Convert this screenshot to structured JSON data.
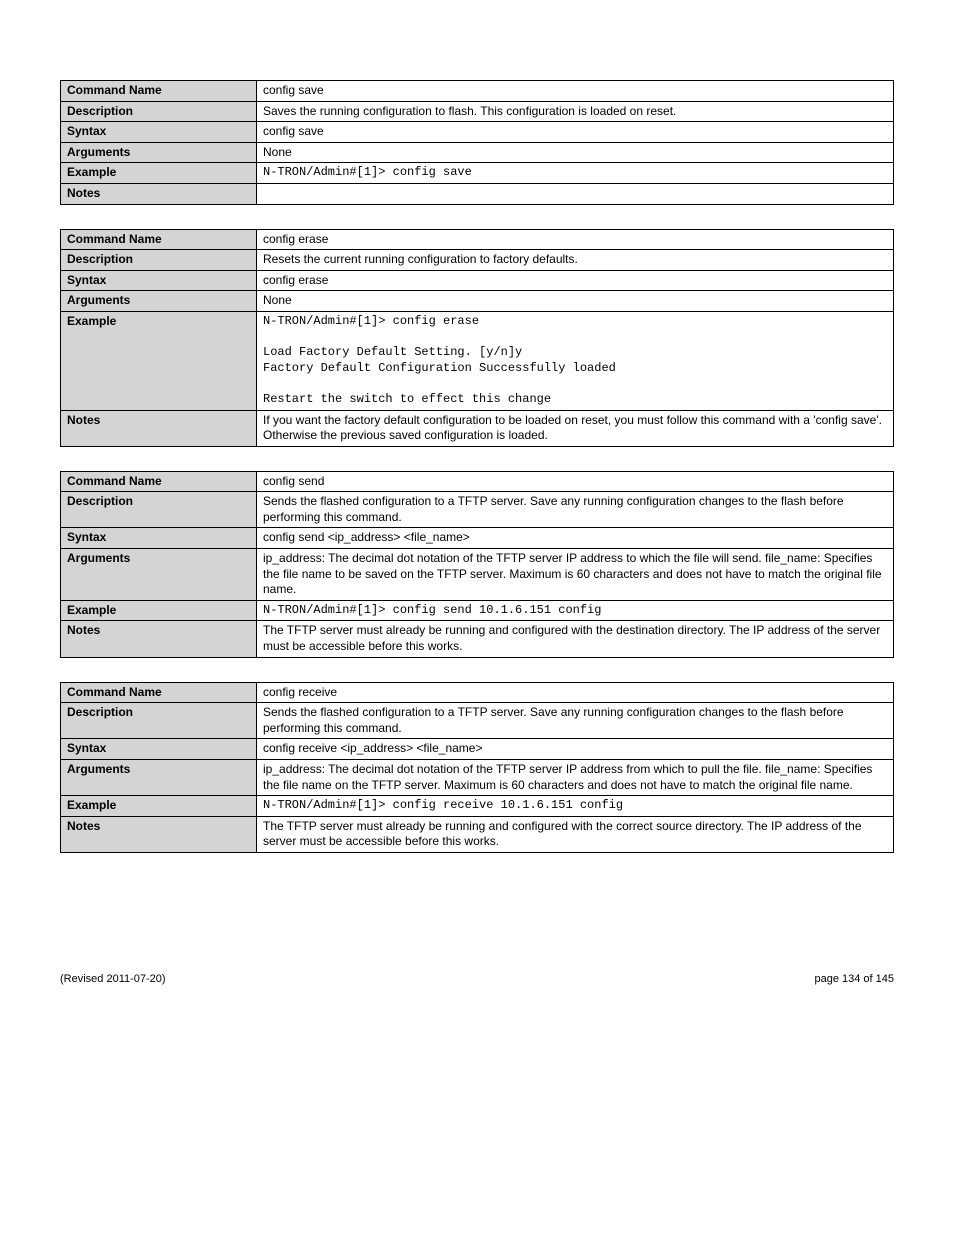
{
  "blocks": [
    {
      "rows": [
        {
          "key": "Command Name",
          "val": "config save",
          "mono": false
        },
        {
          "key": "Description",
          "val": "Saves the running configuration to flash. This configuration is loaded on reset.",
          "mono": false
        },
        {
          "key": "Syntax",
          "val": "config save",
          "mono": false
        },
        {
          "key": "Arguments",
          "val": "None",
          "mono": false
        },
        {
          "key": "Example",
          "val": "N-TRON/Admin#[1]> config save",
          "mono": true
        },
        {
          "key": "Notes",
          "val": "",
          "mono": false
        }
      ]
    },
    {
      "rows": [
        {
          "key": "Command Name",
          "val": "config erase",
          "mono": false
        },
        {
          "key": "Description",
          "val": "Resets the current running configuration to factory defaults.",
          "mono": false
        },
        {
          "key": "Syntax",
          "val": "config erase",
          "mono": false
        },
        {
          "key": "Arguments",
          "val": "None",
          "mono": false
        },
        {
          "key": "Example",
          "val": "N-TRON/Admin#[1]> config erase\n\nLoad Factory Default Setting. [y/n]y\nFactory Default Configuration Successfully loaded\n\nRestart the switch to effect this change",
          "mono": true
        },
        {
          "key": "Notes",
          "val": "If you want the factory default configuration to be loaded on reset, you must follow this command with a 'config save'. Otherwise the previous saved configuration is loaded.",
          "mono": false
        }
      ]
    },
    {
      "rows": [
        {
          "key": "Command Name",
          "val": "config send",
          "mono": false
        },
        {
          "key": "Description",
          "val": "Sends the flashed configuration to a TFTP server. Save any running configuration changes to the flash before performing this command.",
          "mono": false
        },
        {
          "key": "Syntax",
          "val": "config send <ip_address> <file_name>",
          "mono": false
        },
        {
          "key": "Arguments",
          "val": "ip_address: The decimal dot notation of the TFTP server IP address to which the file will send.\nfile_name: Specifies the file name to be saved on the TFTP server. Maximum is 60 characters and does not have to match the original file name.",
          "mono": false
        },
        {
          "key": "Example",
          "val": "N-TRON/Admin#[1]> config send 10.1.6.151 config",
          "mono": true
        },
        {
          "key": "Notes",
          "val": "The TFTP server must already be running and configured with the destination directory. The IP address of the server must be accessible before this works.",
          "mono": false
        }
      ]
    },
    {
      "rows": [
        {
          "key": "Command Name",
          "val": "config receive",
          "mono": false
        },
        {
          "key": "Description",
          "val": "Sends the flashed configuration to a TFTP server. Save any running configuration changes to the flash before performing this command.",
          "mono": false
        },
        {
          "key": "Syntax",
          "val": "config receive <ip_address> <file_name>",
          "mono": false
        },
        {
          "key": "Arguments",
          "val": "ip_address: The decimal dot notation of the TFTP server IP address from which to pull the file.\nfile_name: Specifies the file name on the TFTP server. Maximum is 60 characters and does not have to match the original file name.",
          "mono": false
        },
        {
          "key": "Example",
          "val": "N-TRON/Admin#[1]> config receive 10.1.6.151 config",
          "mono": true
        },
        {
          "key": "Notes",
          "val": "The TFTP server must already be running and configured with the correct source directory. The IP address of the server must be accessible before this works.",
          "mono": false
        }
      ]
    }
  ],
  "footer": {
    "left": "(Revised 2011-07-20)",
    "right": "page 134 of 145"
  }
}
